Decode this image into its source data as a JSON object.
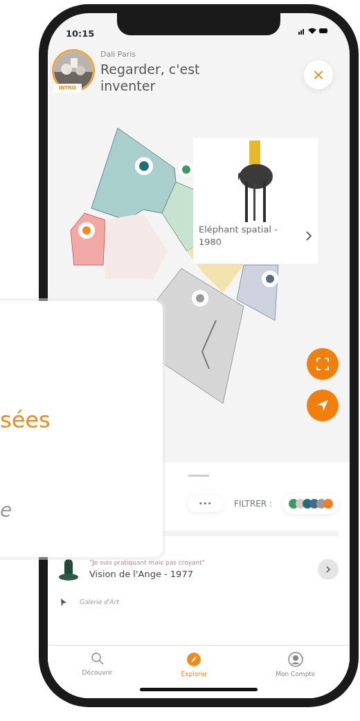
{
  "status_bar": {
    "time": "10:15"
  },
  "header": {
    "venue": "Dali Paris",
    "title": "Regarder, c'est inventer",
    "badge": "INTRO",
    "close": "×"
  },
  "artwork_card": {
    "title": "Eléphant spatial - 1980"
  },
  "filter_bar": {
    "more": "•••",
    "label": "FILTRER :",
    "dots": [
      {
        "color": "#3a9a5c"
      },
      {
        "color": "#d9c9c4"
      },
      {
        "color": "#1f6f78"
      },
      {
        "color": "#4a6a8a"
      },
      {
        "color": "#9a9a9a"
      },
      {
        "color": "#f07f1a"
      }
    ]
  },
  "list": [
    {
      "kind": "artwork",
      "quote": "\"Je suis pratiquant mais pas croyant\"",
      "title": "Vision de l'Ange - 1977"
    },
    {
      "kind": "gallery",
      "quote": "Galerie d'Art"
    }
  ],
  "tabs": [
    {
      "label": "Découvrir",
      "selected": false
    },
    {
      "label": "Explorer",
      "selected": true
    },
    {
      "label": "Mon Compte",
      "selected": false
    }
  ],
  "overlay": {
    "heading": "sées",
    "text": "e"
  }
}
